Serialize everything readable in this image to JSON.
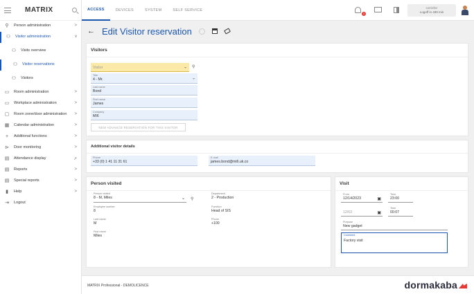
{
  "app": {
    "logo": "MATRIX"
  },
  "sidebar": {
    "items": [
      {
        "label": "Person administration",
        "icon": "person-search-icon",
        "chevron": ">"
      },
      {
        "label": "Visitor administration",
        "icon": "visitor-icon",
        "chevron": "v"
      },
      {
        "label": "Visits overview",
        "icon": "visits-icon"
      },
      {
        "label": "Visitor reservations",
        "icon": "reservation-icon"
      },
      {
        "label": "Visitors",
        "icon": "visitors-icon"
      },
      {
        "label": "Room administration",
        "icon": "room-icon",
        "chevron": ">"
      },
      {
        "label": "Workplace administration",
        "icon": "workplace-icon",
        "chevron": ">"
      },
      {
        "label": "Room zone/door administration",
        "icon": "zone-icon",
        "chevron": ">"
      },
      {
        "label": "Calendar administration",
        "icon": "calendar-icon",
        "chevron": ">"
      },
      {
        "label": "Additional functions",
        "icon": "plus-icon",
        "chevron": ">"
      },
      {
        "label": "Door monitoring",
        "icon": "door-monitor-icon",
        "chevron": ">"
      },
      {
        "label": "Attendance display",
        "icon": "attendance-icon"
      },
      {
        "label": "Reports",
        "icon": "reports-icon",
        "chevron": ">"
      },
      {
        "label": "Special reports",
        "icon": "special-reports-icon",
        "chevron": ">"
      },
      {
        "label": "Help",
        "icon": "help-icon",
        "chevron": ">"
      },
      {
        "label": "Logout",
        "icon": "logout-icon"
      }
    ]
  },
  "topbar": {
    "tabs": [
      "ACCESS",
      "DEVICES",
      "SYSTEM",
      "SELF SERVICE"
    ],
    "notification_count": "1",
    "user": "sotrieller",
    "logoff": "Logoff in 499 min"
  },
  "header": {
    "title": "Edit Visitor reservation"
  },
  "visitors": {
    "title": "Visitors",
    "visitor_placeholder": "Visitor",
    "title_label": "Title",
    "title_value": "4 - Mr.",
    "lastname_label": "Last name",
    "lastname_value": "Bond",
    "firstname_label": "First name",
    "firstname_value": "James",
    "company_label": "Company",
    "company_value": "MI6",
    "new_button": "NEW ADVANCE RESERVATION FOR THIS VISITOR"
  },
  "additional": {
    "title": "Additional visitor details",
    "phone_label": "Phone",
    "phone_value": "+33 (0) 1 41 11 31 61",
    "email_label": "E-mail",
    "email_value": "james.bond@mi6.uk.co"
  },
  "person_visited": {
    "title": "Person visited",
    "person_label": "Person visited",
    "person_value": "8 - M, Miles",
    "employee_label": "Employee number",
    "employee_value": "8",
    "lastname_label": "Last name",
    "lastname_value": "M",
    "firstname_label": "First name",
    "firstname_value": "Miles",
    "department_label": "Department",
    "department_value": "2 - Production",
    "function_label": "Function",
    "function_value": "Head of SIS",
    "phone_label": "Phone",
    "phone_value": "+100"
  },
  "visit": {
    "title": "Visit",
    "from_label": "From",
    "from_value": "12/14/2023",
    "from_time_label": "Time",
    "from_time_value": "23:00",
    "until_value": "12/63",
    "until_time_label": "Time",
    "until_time_value": "00:07",
    "purpose_label": "Purpose",
    "purpose_value": "New gadget",
    "comment_label": "Comment",
    "comment_value": "Factory visit"
  },
  "footer": {
    "text": "MATRIX Professional - DEMOLICENCE",
    "brand": "dormakaba"
  }
}
